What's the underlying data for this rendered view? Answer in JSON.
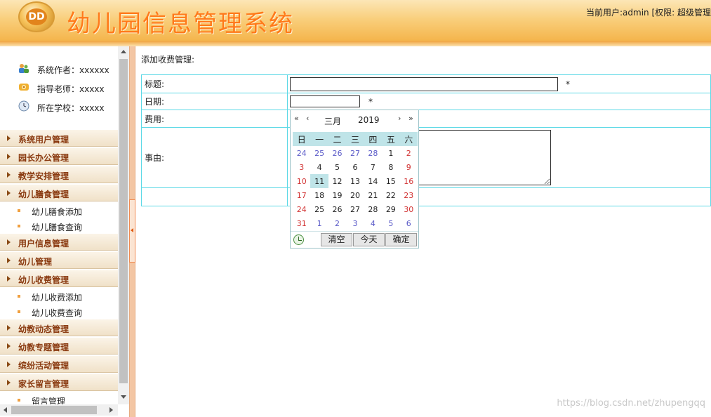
{
  "header": {
    "logo_text": "DD",
    "title": "幼儿园信息管理系统",
    "user_info": "当前用户:admin [权限: 超级管理"
  },
  "sidebar": {
    "info": [
      {
        "icon": "users-icon",
        "label": "系统作者：xxxxxx"
      },
      {
        "icon": "teacher-icon",
        "label": "指导老师：xxxxx"
      },
      {
        "icon": "school-clock-icon",
        "label": "所在学校：xxxxx"
      }
    ],
    "menu": [
      {
        "type": "head",
        "label": "系统用户管理"
      },
      {
        "type": "head",
        "label": "园长办公管理"
      },
      {
        "type": "head",
        "label": "教学安排管理"
      },
      {
        "type": "head",
        "label": "幼儿膳食管理"
      },
      {
        "type": "item",
        "label": "幼儿膳食添加"
      },
      {
        "type": "item",
        "label": "幼儿膳食查询"
      },
      {
        "type": "head",
        "label": "用户信息管理"
      },
      {
        "type": "head",
        "label": "幼儿管理"
      },
      {
        "type": "head",
        "label": "幼儿收费管理"
      },
      {
        "type": "item",
        "label": "幼儿收费添加"
      },
      {
        "type": "item",
        "label": "幼儿收费查询"
      },
      {
        "type": "head",
        "label": "幼教动态管理"
      },
      {
        "type": "head",
        "label": "幼教专题管理"
      },
      {
        "type": "head",
        "label": "缤纷活动管理"
      },
      {
        "type": "head",
        "label": "家长留言管理"
      },
      {
        "type": "item",
        "label": "留言管理"
      }
    ]
  },
  "main": {
    "caption": "添加收费管理:",
    "form": {
      "title_label": "标题:",
      "date_label": "日期:",
      "fee_label": "费用:",
      "reason_label": "事由:",
      "required_mark": "*",
      "title_value": "",
      "date_value": "",
      "fee_value": "",
      "reason_value": ""
    }
  },
  "datepicker": {
    "prev_year": "«",
    "prev_month": "‹",
    "next_month": "›",
    "next_year": "»",
    "month": "三月",
    "year": "2019",
    "weekdays": [
      "日",
      "一",
      "二",
      "三",
      "四",
      "五",
      "六"
    ],
    "weeks": [
      [
        "24",
        "25",
        "26",
        "27",
        "28",
        "1",
        "2"
      ],
      [
        "3",
        "4",
        "5",
        "6",
        "7",
        "8",
        "9"
      ],
      [
        "10",
        "11",
        "12",
        "13",
        "14",
        "15",
        "16"
      ],
      [
        "17",
        "18",
        "19",
        "20",
        "21",
        "22",
        "23"
      ],
      [
        "24",
        "25",
        "26",
        "27",
        "28",
        "29",
        "30"
      ],
      [
        "31",
        "1",
        "2",
        "3",
        "4",
        "5",
        "6"
      ]
    ],
    "today": "11",
    "clear_label": "清空",
    "today_label": "今天",
    "ok_label": "确定"
  },
  "watermark": "https://blog.csdn.net/zhupengqq",
  "colors": {
    "accent_orange": "#ff7a1a",
    "table_border": "#5dd9e6",
    "menu_text": "#8a3a10",
    "weekend_red": "#d23434",
    "other_month_blue": "#5a5ac8"
  }
}
